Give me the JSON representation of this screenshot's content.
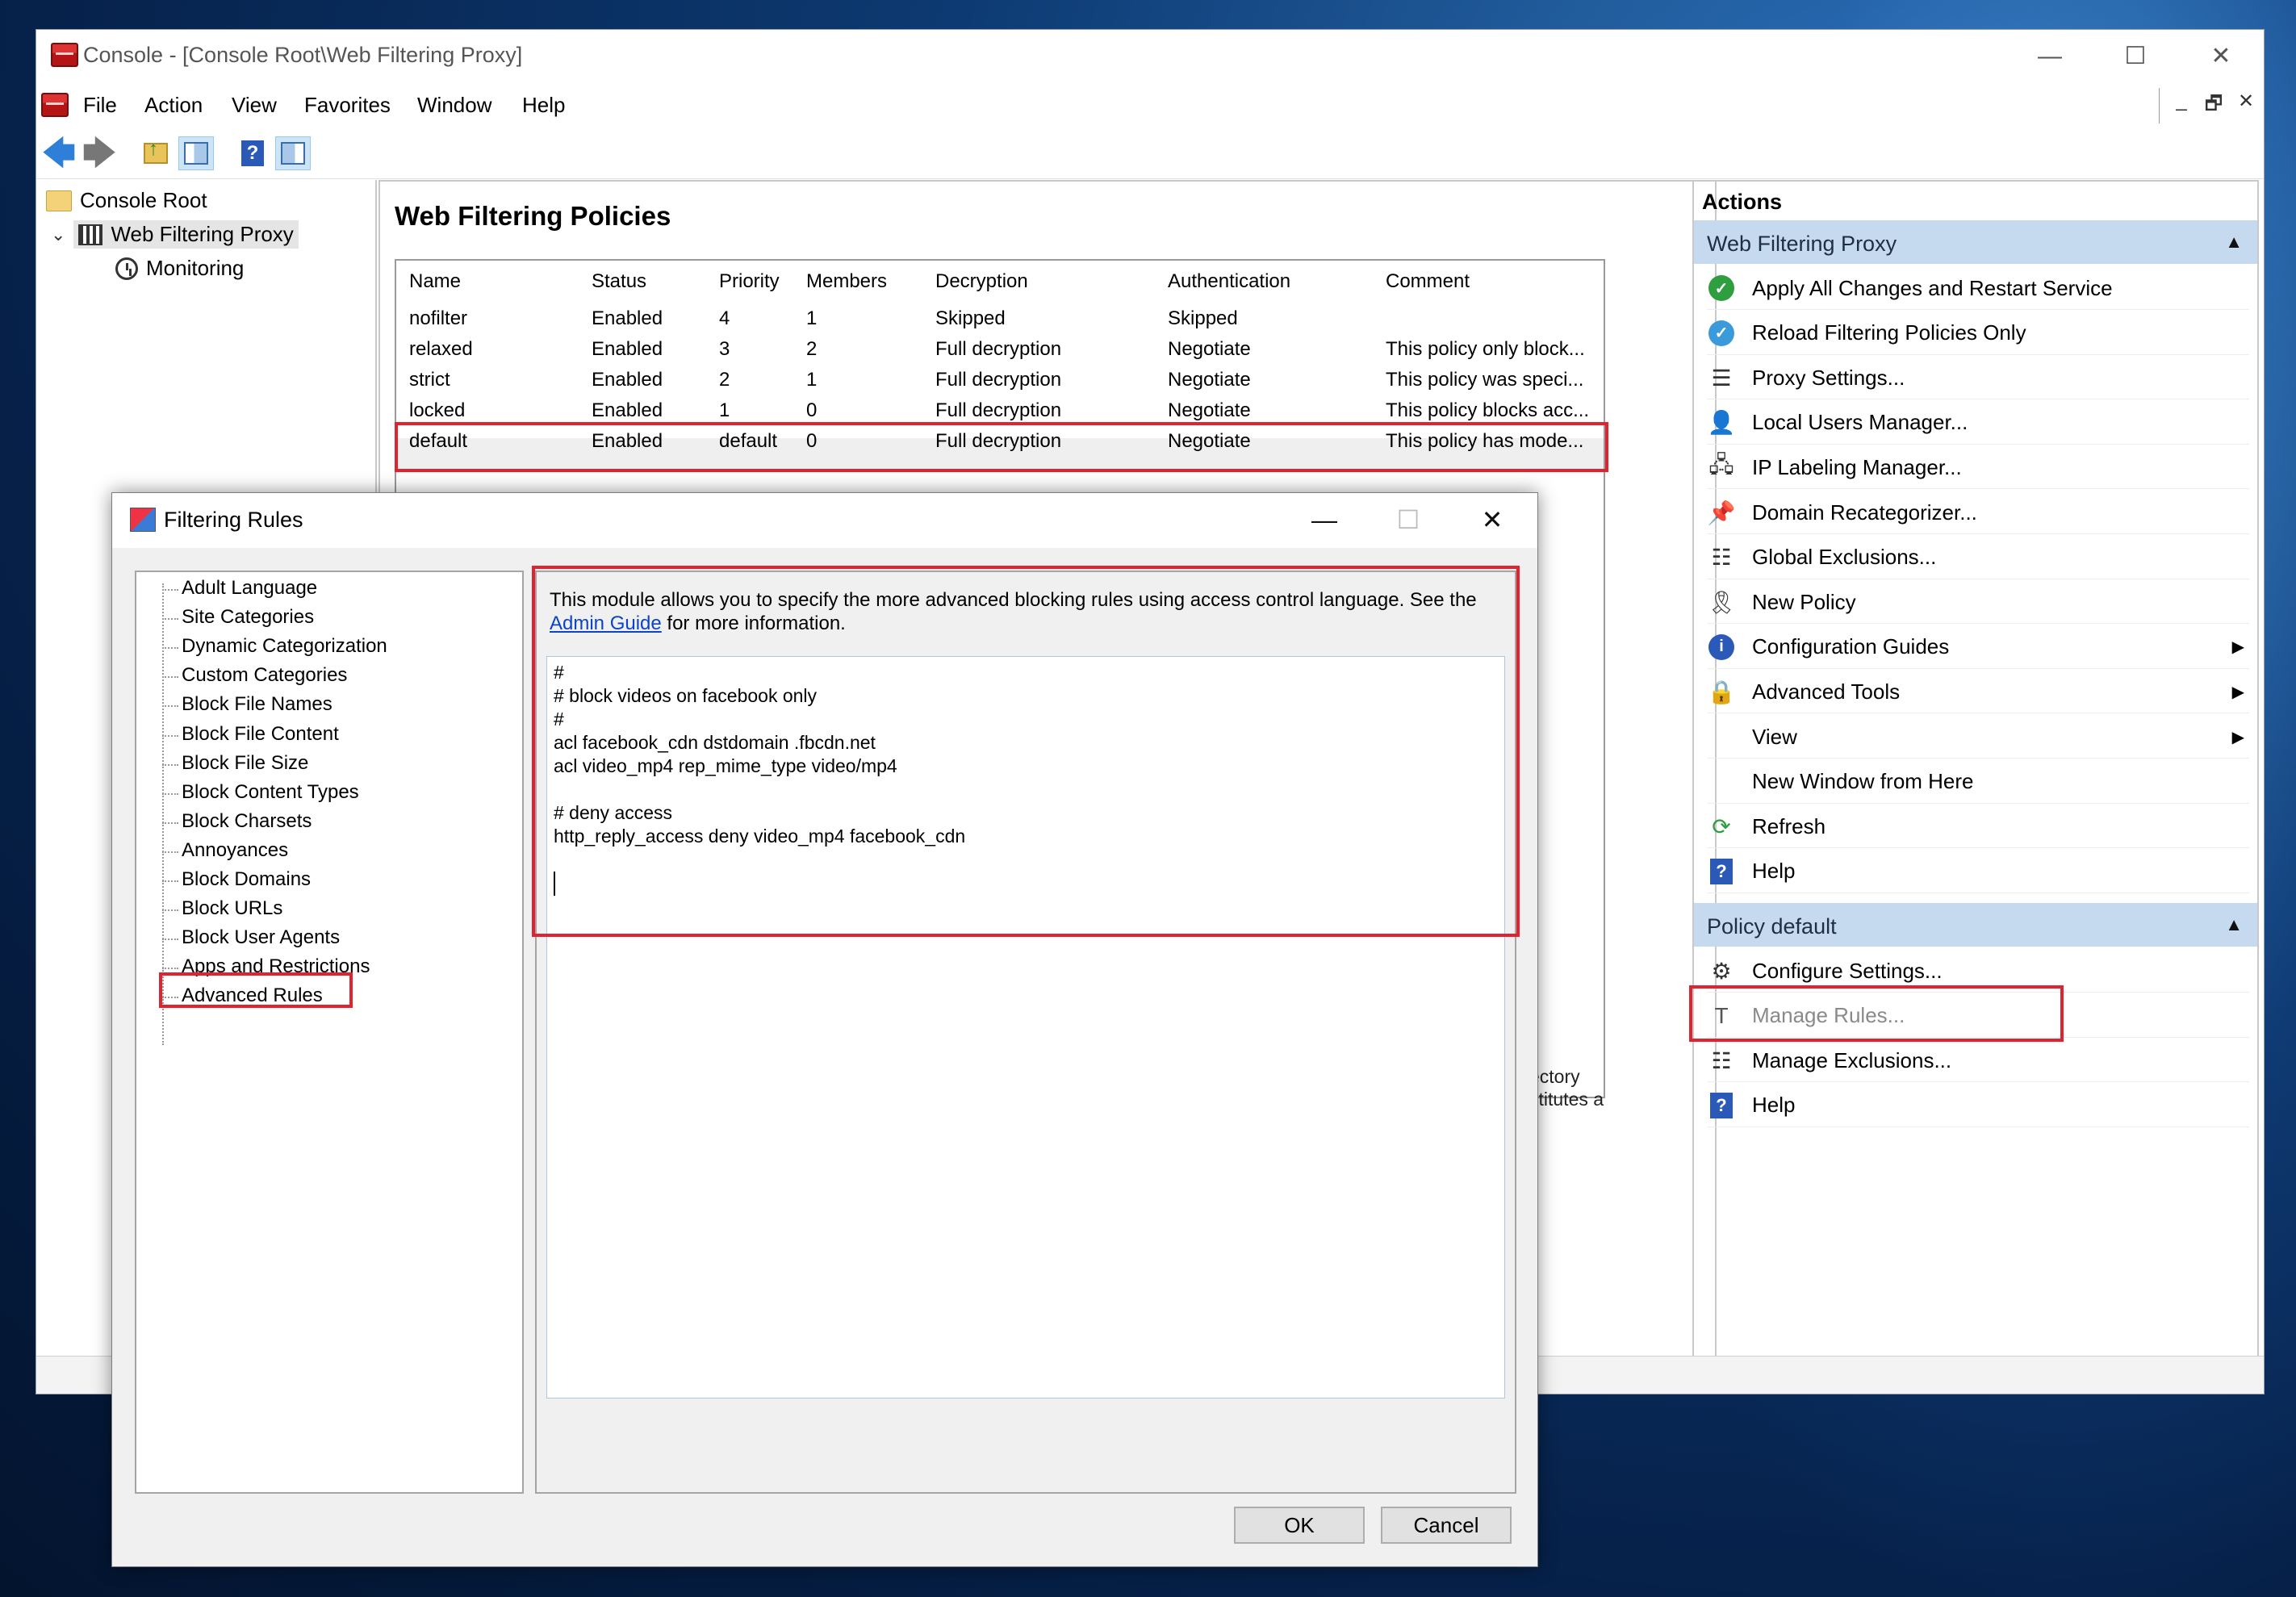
{
  "window": {
    "title": "Console - [Console Root\\Web Filtering Proxy]",
    "controls": {
      "minimize": "—",
      "maximize": "☐",
      "close": "✕"
    }
  },
  "menu": [
    "File",
    "Action",
    "View",
    "Favorites",
    "Window",
    "Help"
  ],
  "mdi_controls": {
    "minimize": "_",
    "restore": "🗗",
    "close": "✕"
  },
  "toolbar": {
    "back": "🡄",
    "forward": "🡆",
    "help": "?"
  },
  "tree": {
    "root": "Console Root",
    "proxy": "Web Filtering Proxy",
    "monitoring": "Monitoring"
  },
  "center": {
    "title": "Web Filtering Policies",
    "columns": [
      "Name",
      "Status",
      "Priority",
      "Members",
      "Decryption",
      "Authentication",
      "Comment"
    ],
    "rows": [
      [
        "nofilter",
        "Enabled",
        "4",
        "1",
        "Skipped",
        "Skipped",
        ""
      ],
      [
        "relaxed",
        "Enabled",
        "3",
        "2",
        "Full decryption",
        "Negotiate",
        "This policy only block..."
      ],
      [
        "strict",
        "Enabled",
        "2",
        "1",
        "Full decryption",
        "Negotiate",
        "This policy was speci..."
      ],
      [
        "locked",
        "Enabled",
        "1",
        "0",
        "Full decryption",
        "Negotiate",
        "This policy blocks acc..."
      ],
      [
        "default",
        "Enabled",
        "default",
        "0",
        "Full decryption",
        "Negotiate",
        "This policy has mode..."
      ]
    ],
    "partial_text": [
      "ectory",
      "stitutes a"
    ]
  },
  "actions": {
    "header": "Actions",
    "section1": {
      "title": "Web Filtering Proxy",
      "items": [
        "Apply All Changes and Restart Service",
        "Reload Filtering Policies Only",
        "Proxy Settings...",
        "Local Users Manager...",
        "IP Labeling Manager...",
        "Domain Recategorizer...",
        "Global Exclusions...",
        "New Policy",
        "Configuration Guides",
        "Advanced Tools",
        "View",
        "New Window from Here",
        "Refresh",
        "Help"
      ]
    },
    "section2": {
      "title": "Policy default",
      "items": [
        "Configure Settings...",
        "Manage Rules...",
        "Manage Exclusions...",
        "Help"
      ]
    }
  },
  "dialog": {
    "title": "Filtering Rules",
    "rules": [
      "Adult Language",
      "Site Categories",
      "Dynamic Categorization",
      "Custom Categories",
      "Block File Names",
      "Block File Content",
      "Block File Size",
      "Block Content Types",
      "Block Charsets",
      "Annoyances",
      "Block Domains",
      "Block URLs",
      "Block User Agents",
      "Apps and Restrictions",
      "Advanced Rules"
    ],
    "selected_rule": "Advanced Rules",
    "description_prefix": "This module allows you to specify the more advanced blocking rules using access control language. See the ",
    "description_link": "Admin Guide",
    "description_suffix": " for more information.",
    "code_lines": [
      "#",
      "# block videos on facebook only",
      "#",
      "acl facebook_cdn dstdomain .fbcdn.net",
      "acl video_mp4 rep_mime_type video/mp4",
      "",
      "# deny access",
      "http_reply_access deny video_mp4 facebook_cdn"
    ],
    "ok": "OK",
    "cancel": "Cancel"
  }
}
